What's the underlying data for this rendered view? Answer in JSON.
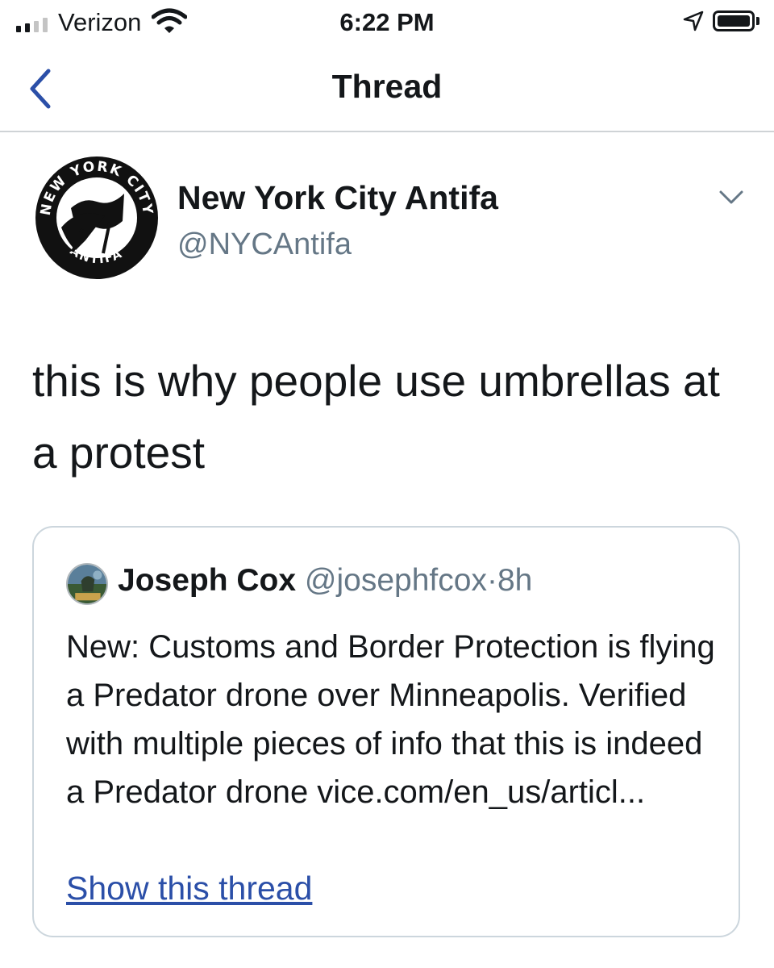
{
  "status_bar": {
    "carrier": "Verizon",
    "time": "6:22 PM",
    "icons": [
      "signal-bars-icon",
      "wifi-icon",
      "location-arrow-icon",
      "battery-icon"
    ]
  },
  "nav": {
    "title": "Thread",
    "back_icon": "chevron-left-icon"
  },
  "tweet": {
    "author_name": "New York City Antifa",
    "author_handle": "@NYCAntifa",
    "avatar_logo_text": [
      "NEW YORK CITY",
      "ANTIFA"
    ],
    "text": "this is why people use umbrellas at a protest",
    "menu_icon": "chevron-down-icon"
  },
  "quoted_tweet": {
    "author_name": "Joseph Cox",
    "author_handle": "@josephfcox",
    "separator": "·",
    "time_ago": "8h",
    "text": "New: Customs and Border Protection is flying a Predator drone over Minneapolis. Verified with multiple pieces of info that this is indeed a Predator drone vice.com/en_us/articl...",
    "show_thread_label": "Show this thread"
  },
  "colors": {
    "text_primary": "#14171a",
    "text_secondary": "#657786",
    "link": "#2b4fa8",
    "border": "#ccd6dd"
  }
}
